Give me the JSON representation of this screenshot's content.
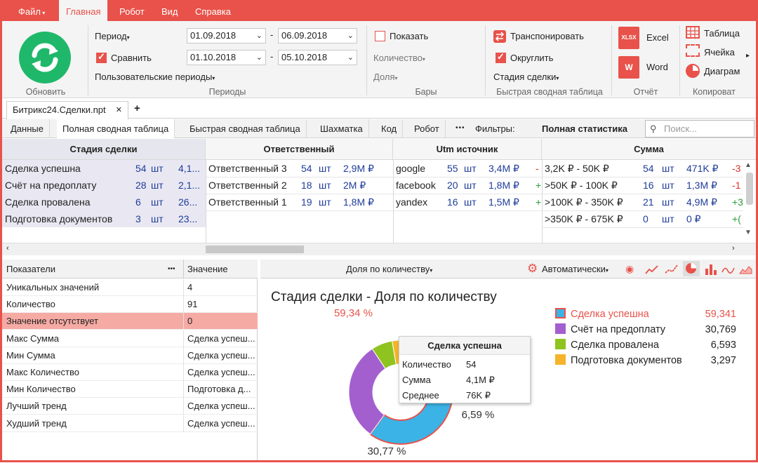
{
  "colors": {
    "accent": "#e8524a",
    "green": "#1fb86a"
  },
  "menu": {
    "file": "Файл",
    "tabs": [
      "Главная",
      "Робот",
      "Вид",
      "Справка"
    ]
  },
  "ribbon": {
    "refresh_label": "Обновить",
    "period_label": "Период",
    "compare_label": "Сравнить",
    "custom_periods_label": "Пользовательские периоды",
    "period1_from": "01.09.2018",
    "period1_to": "06.09.2018",
    "period2_from": "01.10.2018",
    "period2_to": "05.10.2018",
    "dash": "-",
    "periods_group": "Периоды",
    "show_label": "Показать",
    "quantity_label": "Количество",
    "share_label": "Доля",
    "bars_group": "Бары",
    "transpose_label": "Транспонировать",
    "round_label": "Округлить",
    "deal_stage_label": "Стадия сделки",
    "quick_pivot_group": "Быстрая сводная таблица",
    "excel_label": "Excel",
    "word_label": "Word",
    "xlsx_icon_text": "XLSX",
    "w_icon_text": "W",
    "report_group": "Отчёт",
    "table_label": "Таблица",
    "cell_label": "Ячейка",
    "diagram_label": "Диаграм",
    "copy_group": "Копироват"
  },
  "document_tab": {
    "title": "Битрикс24.Сделки.npt",
    "close": "✕",
    "add": "+"
  },
  "view_tabs": [
    "Данные",
    "Полная сводная таблица",
    "Быстрая сводная таблица",
    "Шахматка",
    "Код",
    "Робот"
  ],
  "filters_dots": "•••",
  "filters_label": "Фильтры:",
  "full_stats_label": "Полная статистика",
  "search_placeholder": "Поиск...",
  "grid": {
    "headers": [
      "Стадия сделки",
      "Ответственный",
      "Utm источник",
      "Сумма"
    ],
    "stage_rows": [
      {
        "name": "Сделка успешна",
        "count": "54",
        "unit": "шт",
        "extra": "4,1..."
      },
      {
        "name": "Счёт на предоплату",
        "count": "28",
        "unit": "шт",
        "extra": "2,1..."
      },
      {
        "name": "Сделка провалена",
        "count": "6",
        "unit": "шт",
        "extra": "26..."
      },
      {
        "name": "Подготовка документов",
        "count": "3",
        "unit": "шт",
        "extra": "23..."
      }
    ],
    "resp_rows": [
      {
        "name": "Ответственный 3",
        "count": "54",
        "unit": "шт",
        "sum": "2,9М ₽"
      },
      {
        "name": "Ответственный 2",
        "count": "18",
        "unit": "шт",
        "sum": "2М ₽"
      },
      {
        "name": "Ответственный 1",
        "count": "19",
        "unit": "шт",
        "sum": "1,8М ₽"
      }
    ],
    "utm_rows": [
      {
        "name": "google",
        "count": "55",
        "unit": "шт",
        "sum": "3,4М ₽",
        "delta": "-"
      },
      {
        "name": "facebook",
        "count": "20",
        "unit": "шт",
        "sum": "1,8М ₽",
        "delta": "+"
      },
      {
        "name": "yandex",
        "count": "16",
        "unit": "шт",
        "sum": "1,5М ₽",
        "delta": "+"
      }
    ],
    "sum_rows": [
      {
        "range": "3,2K ₽ - 50K ₽",
        "count": "54",
        "unit": "шт",
        "sum": "471K ₽",
        "delta": "-3"
      },
      {
        "range": ">50K ₽ - 100K ₽",
        "count": "16",
        "unit": "шт",
        "sum": "1,3М ₽",
        "delta": "-1"
      },
      {
        "range": ">100K ₽ - 350K ₽",
        "count": "21",
        "unit": "шт",
        "sum": "4,9М ₽",
        "delta": "+3"
      },
      {
        "range": ">350K ₽ - 675K ₽",
        "count": "0",
        "unit": "шт",
        "sum": "0 ₽",
        "delta": "+("
      }
    ]
  },
  "indicators": {
    "col_indicator": "Показатели",
    "col_value": "Значение",
    "dots": "•••",
    "rows": [
      {
        "name": "Уникальных значений",
        "value": "4"
      },
      {
        "name": "Количество",
        "value": "91"
      },
      {
        "name": "Значение отсутствует",
        "value": "0"
      },
      {
        "name": "Макс Сумма",
        "value": "Сделка успеш..."
      },
      {
        "name": "Мин Сумма",
        "value": "Сделка успеш..."
      },
      {
        "name": "Макс Количество",
        "value": "Сделка успеш..."
      },
      {
        "name": "Мин Количество",
        "value": "Подготовка д..."
      },
      {
        "name": "Лучший тренд",
        "value": "Сделка успеш..."
      },
      {
        "name": "Худший тренд",
        "value": "Сделка успеш..."
      }
    ]
  },
  "chart_panel": {
    "mode_label": "Доля по количеству",
    "auto_label": "Автоматически",
    "tooltip": {
      "title": "Сделка успешна",
      "rows": [
        {
          "label": "Количество",
          "value": "54"
        },
        {
          "label": "Сумма",
          "value": "4,1М ₽"
        },
        {
          "label": "Среднее",
          "value": "76K ₽"
        }
      ]
    }
  },
  "chart_data": {
    "type": "pie",
    "title": "Стадия сделки - Доля по количеству",
    "categories": [
      "Сделка успешна",
      "Счёт на предоплату",
      "Сделка провалена",
      "Подготовка документов"
    ],
    "values": [
      59.341,
      30.769,
      6.593,
      3.297
    ],
    "value_labels": [
      "59,341",
      "30,769",
      "6,593",
      "3,297"
    ],
    "slice_labels": [
      "59,34 %",
      "30,77 %",
      "6,59 %",
      ""
    ],
    "colors": [
      "#3bb3e6",
      "#a45fcf",
      "#8fc31f",
      "#f5b42a"
    ],
    "legend_position": "right"
  }
}
